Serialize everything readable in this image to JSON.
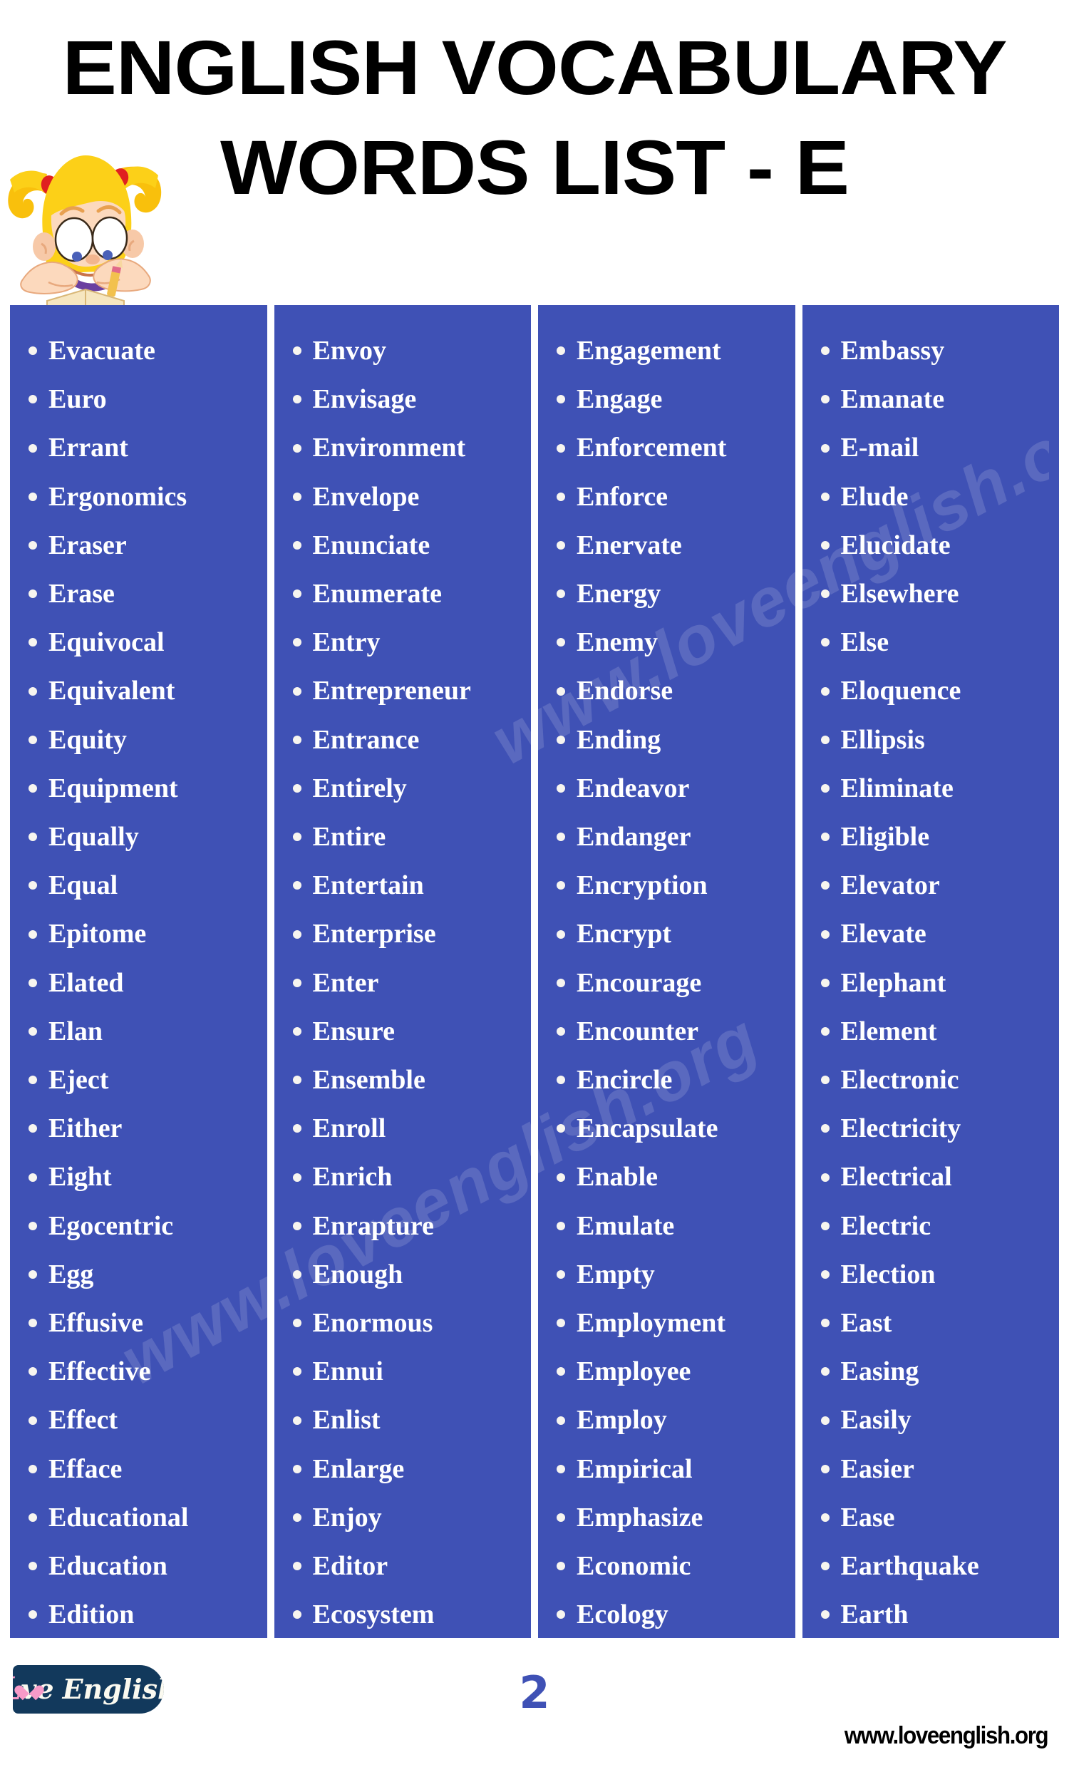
{
  "header": {
    "title_line_1": "ENGLISH VOCABULARY",
    "title_line_2": "WORDS LIST - E",
    "mascot_icon": "girl-studying-icon"
  },
  "theme": {
    "panel_blue": "#3f51b5",
    "word_text": "#ffffff",
    "bullet": "#f7f5ef",
    "page_number_blue": "#3f51b5",
    "logo_badge_navy": "#12395c",
    "logo_pink": "#f79ac8",
    "logo_cream": "#fbfaf0",
    "page_background": "#ffffff"
  },
  "watermark": {
    "line_1": "www.loveenglish.org",
    "line_2": "www.loveenglish.org"
  },
  "columns": [
    {
      "index": 1,
      "words": [
        "Evacuate",
        "Euro",
        "Errant",
        "Ergonomics",
        "Eraser",
        "Erase",
        "Equivocal",
        "Equivalent",
        "Equity",
        "Equipment",
        "Equally",
        "Equal",
        "Epitome",
        "Elated",
        "Elan",
        "Eject",
        "Either",
        "Eight",
        "Egocentric",
        "Egg",
        "Effusive",
        "Effective",
        "Effect",
        "Efface",
        "Educational",
        "Education",
        "Edition"
      ]
    },
    {
      "index": 2,
      "words": [
        "Envoy",
        "Envisage",
        "Environment",
        "Envelope",
        "Enunciate",
        "Enumerate",
        "Entry",
        "Entrepreneur",
        "Entrance",
        "Entirely",
        "Entire",
        "Entertain",
        "Enterprise",
        "Enter",
        "Ensure",
        "Ensemble",
        "Enroll",
        "Enrich",
        "Enrapture",
        "Enough",
        "Enormous",
        "Ennui",
        "Enlist",
        "Enlarge",
        "Enjoy",
        "Editor",
        "Ecosystem"
      ]
    },
    {
      "index": 3,
      "words": [
        "Engagement",
        "Engage",
        "Enforcement",
        "Enforce",
        "Enervate",
        "Energy",
        "Enemy",
        "Endorse",
        "Ending",
        "Endeavor",
        "Endanger",
        "Encryption",
        "Encrypt",
        "Encourage",
        "Encounter",
        "Encircle",
        "Encapsulate",
        "Enable",
        "Emulate",
        "Empty",
        "Employment",
        "Employee",
        "Employ",
        "Empirical",
        "Emphasize",
        "Economic",
        "Ecology"
      ]
    },
    {
      "index": 4,
      "words": [
        "Embassy",
        "Emanate",
        "E-mail",
        "Elude",
        "Elucidate",
        "Elsewhere",
        "Else",
        "Eloquence",
        "Ellipsis",
        "Eliminate",
        "Eligible",
        "Elevator",
        "Elevate",
        "Elephant",
        "Element",
        "Electronic",
        "Electricity",
        "Electrical",
        "Electric",
        "Election",
        "East",
        "Easing",
        "Easily",
        "Easier",
        "Ease",
        "Earthquake",
        "Earth"
      ]
    }
  ],
  "footer": {
    "logo_L": "L",
    "logo_heart_icon": "heart-icon",
    "logo_ve": "ve",
    "logo_english": "English",
    "page_number": "2",
    "site_url": "www.loveenglish.org"
  }
}
